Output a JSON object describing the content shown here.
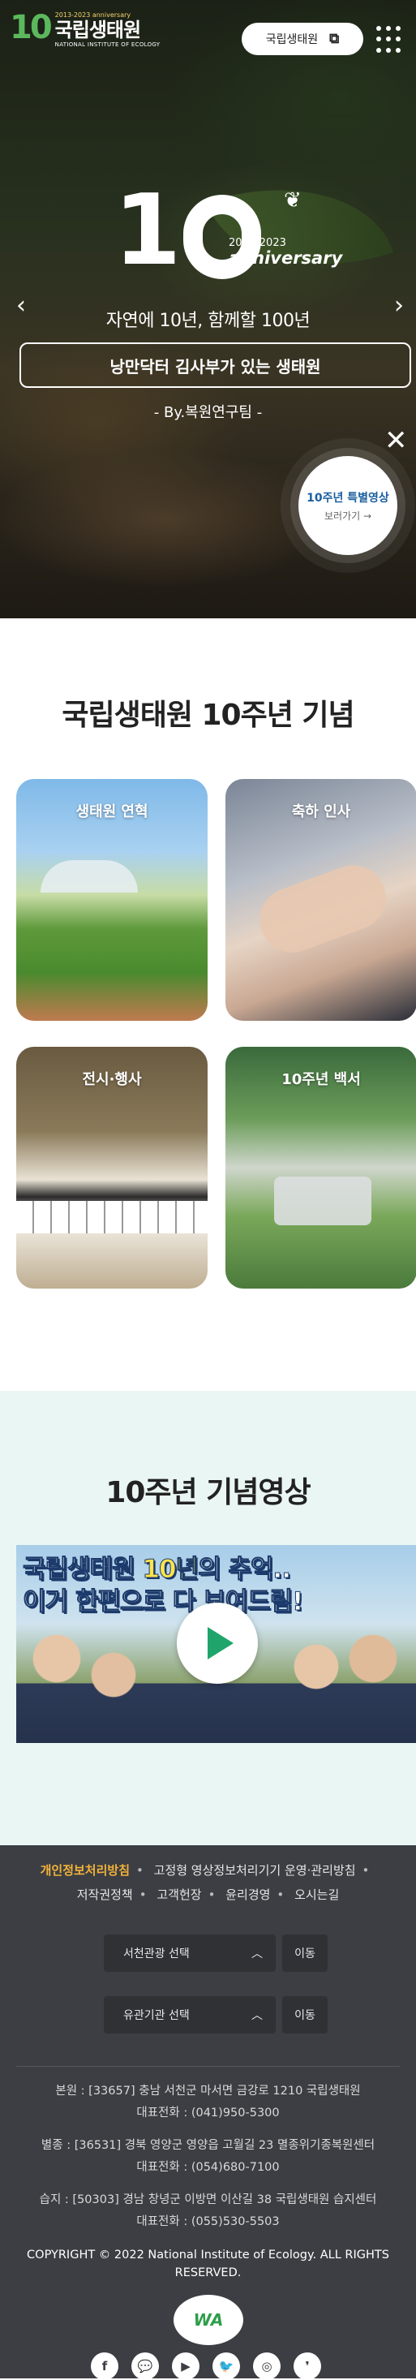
{
  "header": {
    "logo_mark": "10",
    "logo_anniv": "2013-2023 anniversary",
    "logo_name": "국립생태원",
    "logo_en": "NATIONAL INSTITUTE OF ECOLOGY",
    "site_button": "국립생태원",
    "menu_icon": "grid-dots-icon"
  },
  "hero": {
    "big_number": "1",
    "anniv_years": "2013-2023",
    "anniv_word": "anniversary",
    "tagline": "자연에 10년, 함께할 100년",
    "story_title": "낭만닥터 김사부가 있는 생태원",
    "byline": "- By.복원연구팀 -",
    "badge_title": "10주년 특별영상",
    "badge_sub": "보러가기 →"
  },
  "anniversary": {
    "title": "국립생태원 10주년 기념",
    "cards": [
      {
        "label": "생태원 연혁"
      },
      {
        "label": "축하 인사"
      },
      {
        "label": "전시·행사"
      },
      {
        "label": "10주년 백서"
      }
    ]
  },
  "video_section": {
    "title": "10주년 기념영상",
    "thumb_line1_a": "국립생태원 ",
    "thumb_line1_hl": "10년",
    "thumb_line1_b": "의 추억..",
    "thumb_line2": "이거 한편으로 다 보여드림!"
  },
  "footer": {
    "nav": [
      "개인정보처리방침",
      "고정형 영상정보처리기기 운영·관리방침",
      "저작권정책",
      "고객헌장",
      "윤리경영",
      "오시는길"
    ],
    "select1": "서천관광 선택",
    "select2": "유관기관 선택",
    "go_label": "이동",
    "addr1_line1": "본원 : [33657] 충남 서천군 마서면 금강로 1210 국립생태원",
    "addr1_line2": "대표전화 : (041)950-5300",
    "addr2_line1": "별종 : [36531] 경북 영양군 영양읍 고월길 23 멸종위기종복원센터",
    "addr2_line2": "대표전화 : (054)680-7100",
    "addr3_line1": "습지 : [50303] 경남 창녕군 이방면 이산길 38 국립생태원 습지센터",
    "addr3_line2": "대표전화 : (055)530-5503",
    "copyright": "COPYRIGHT © 2022 National Institute of Ecology. ALL RIGHTS RESERVED.",
    "wa_mark": "WA",
    "social": [
      "f",
      "💬",
      "▶",
      "🐦",
      "◎",
      "❜"
    ]
  },
  "colors": {
    "accent": "#f2b23a",
    "brand_green": "#1fa56b",
    "footer_bg": "#3c3e43",
    "video_bg": "#eaf6f3"
  }
}
